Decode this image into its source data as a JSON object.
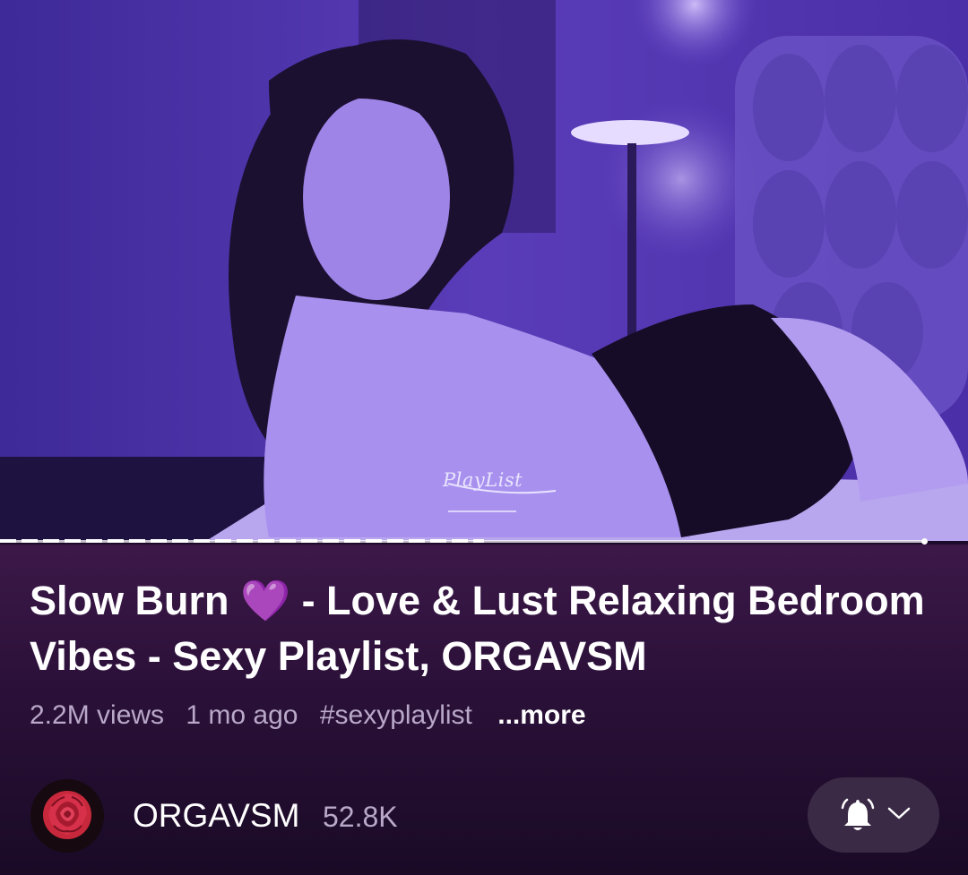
{
  "video": {
    "overlay_text": "PlayList",
    "progress_fraction": 0.5
  },
  "title": {
    "part1": "Slow Burn",
    "emoji": "💜",
    "part2": "- Love & Lust Relaxing Bedroom Vibes - Sexy Playlist, ORGAVSM"
  },
  "meta": {
    "views": "2.2M views",
    "age": "1 mo ago",
    "hashtag": "#sexyplaylist",
    "more_label": "...more"
  },
  "channel": {
    "name": "ORGAVSM",
    "subscribers": "52.8K",
    "avatar_icon": "rose-icon"
  },
  "subscribe": {
    "icon": "bell-icon",
    "dropdown_icon": "chevron-down-icon"
  },
  "colors": {
    "heart": "#b84cff",
    "muted_text": "#b9a8c8",
    "button_bg": "#3b2a46"
  }
}
